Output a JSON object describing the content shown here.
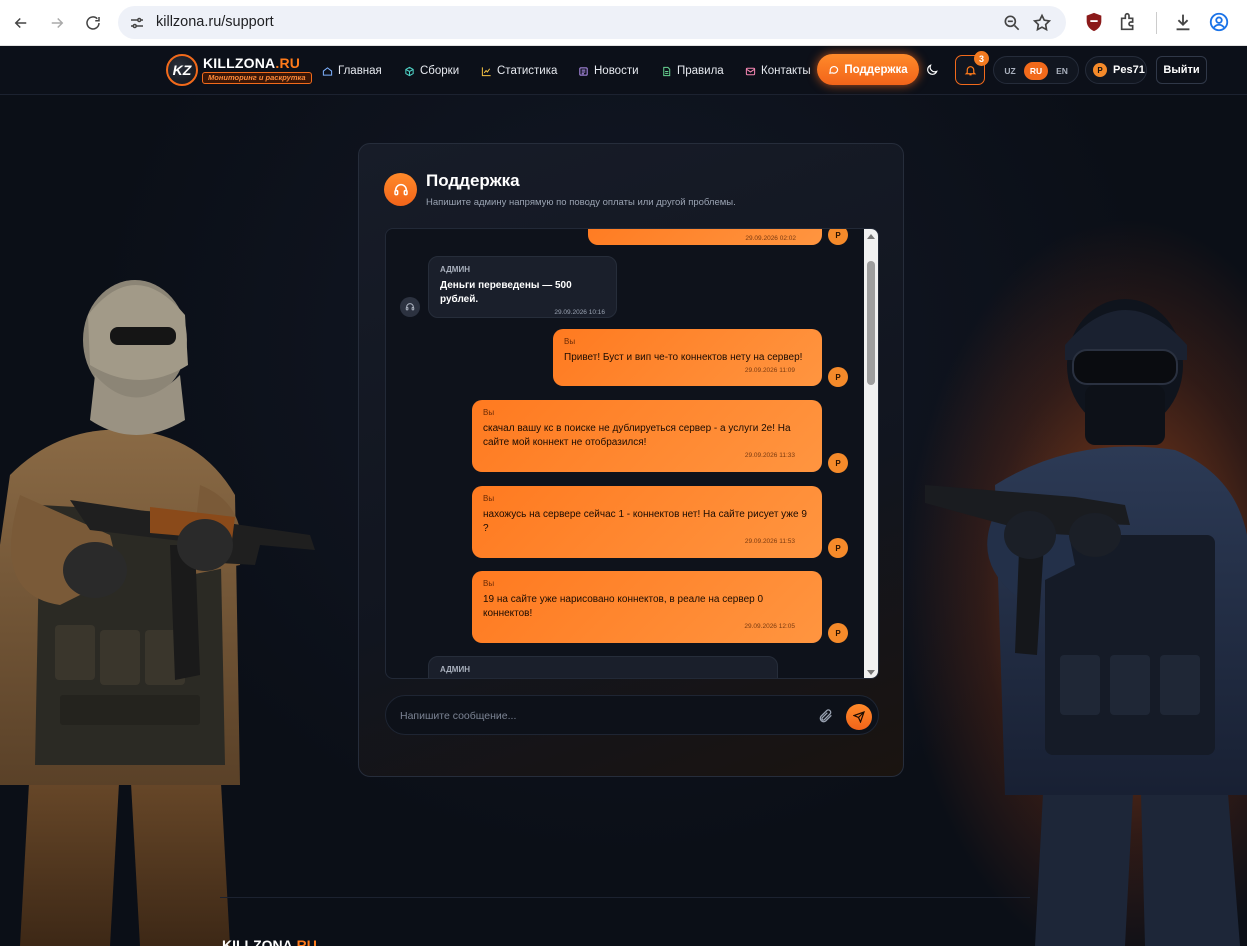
{
  "browser": {
    "url": "killzona.ru/support"
  },
  "header": {
    "logo_badge": "KZ",
    "logo_name": "KILLZONA",
    "logo_tld": ".RU",
    "logo_tagline": "Мониторинг и раскрутка",
    "nav": [
      {
        "label": "Главная",
        "icon": "home-icon"
      },
      {
        "label": "Сборки",
        "icon": "cube-icon"
      },
      {
        "label": "Статистика",
        "icon": "chart-icon"
      },
      {
        "label": "Новости",
        "icon": "newspaper-icon"
      },
      {
        "label": "Правила",
        "icon": "document-icon"
      },
      {
        "label": "Контакты",
        "icon": "mail-icon"
      }
    ],
    "support_label": "Поддержка",
    "notifications_count": "3",
    "languages": [
      "UZ",
      "RU",
      "EN"
    ],
    "active_language": "RU",
    "user_initial": "P",
    "username": "Pes71",
    "logout_label": "Выйти"
  },
  "support": {
    "title": "Поддержка",
    "subtitle": "Напишите админу напрямую по поводу оплаты или другой проблемы.",
    "input_placeholder": "Напишите сообщение...",
    "messages": [
      {
        "from": "me",
        "sender": "",
        "text": "",
        "time": "29.09.2026 02:02"
      },
      {
        "from": "admin",
        "sender": "АДМИН",
        "text": "Деньги переведены — 500 рублей.",
        "time": "29.09.2026 10:16"
      },
      {
        "from": "me",
        "sender": "Вы",
        "text": "Привет! Буст и вип че-то коннектов нету на сервер!",
        "time": "29.09.2026 11:09"
      },
      {
        "from": "me",
        "sender": "Вы",
        "text": "скачал вашу кс в поиске не дублируеться сервер - а услуги 2е! На сайте мой коннект не отобразился!",
        "time": "29.09.2026 11:33"
      },
      {
        "from": "me",
        "sender": "Вы",
        "text": "нахожусь на сервере сейчас 1 - коннектов нет! На сайте рисует уже 9 ?",
        "time": "29.09.2026 11:53"
      },
      {
        "from": "me",
        "sender": "Вы",
        "text": "19 на сайте уже нарисовано коннектов, в реале на сервер 0 коннектов!",
        "time": "29.09.2026 12:05"
      },
      {
        "from": "admin",
        "sender": "АДМИН",
        "text": "",
        "time": ""
      }
    ],
    "my_avatar_initial": "P"
  },
  "footer": {
    "logo_name": "KILLZONA",
    "logo_tld": ".RU"
  }
}
